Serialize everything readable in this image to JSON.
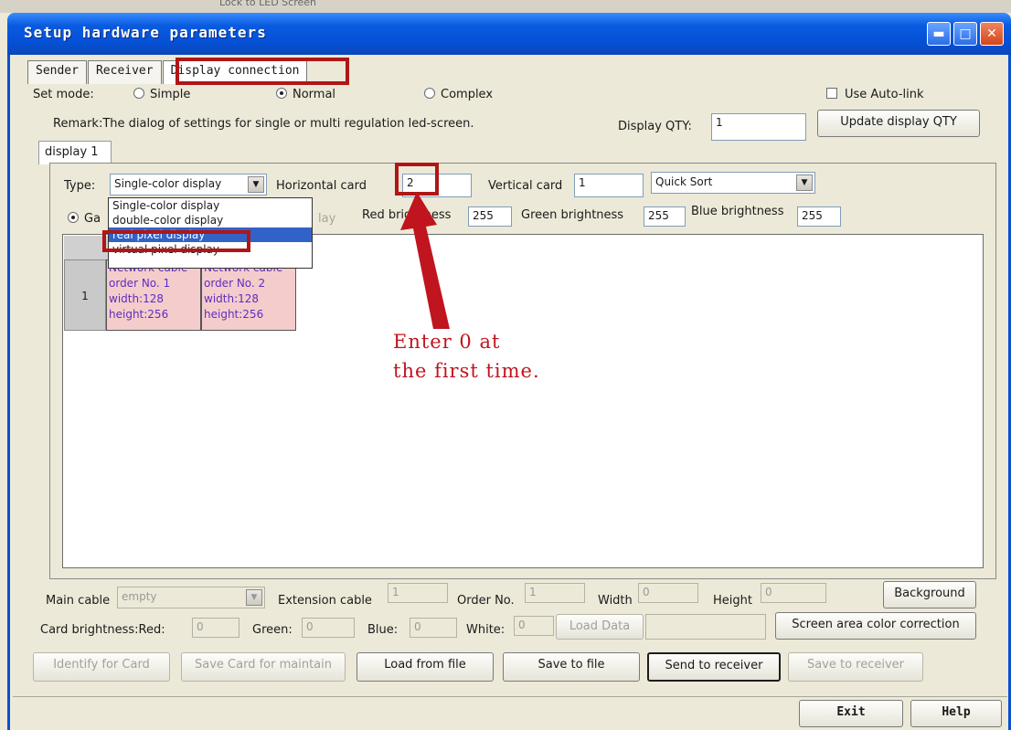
{
  "window": {
    "title": "Setup hardware parameters",
    "background_title_fragment": "Lock to LED Screen"
  },
  "tabs": [
    "Sender",
    "Receiver",
    "Display connection"
  ],
  "set_mode": {
    "label": "Set mode:",
    "options": [
      "Simple",
      "Normal",
      "Complex"
    ],
    "selected": "Normal"
  },
  "auto_link": {
    "label": "Use Auto-link",
    "checked": false
  },
  "remark": "Remark:The dialog of settings for single or multi  regulation led-screen.",
  "display_qty": {
    "label": "Display QTY:",
    "value": "1",
    "update_button": "Update display QTY"
  },
  "display_tab": "display 1",
  "type": {
    "label": "Type:",
    "value": "Single-color display",
    "options": [
      "Single-color display",
      "double-color display",
      "real pixel display",
      "virtual pixel display"
    ],
    "highlighted": "real pixel display"
  },
  "horizontal_card": {
    "label": "Horizontal card",
    "value": "2"
  },
  "vertical_card": {
    "label": "Vertical card",
    "value": "1"
  },
  "sort": {
    "value": "Quick Sort"
  },
  "mode_radio_partial": "Ga",
  "partial_lay": "lay",
  "brightness": {
    "red_label": "Red brightness",
    "red": "255",
    "green_label": "Green brightness",
    "green": "255",
    "blue_label": "Blue brightness",
    "blue": "255"
  },
  "grid": {
    "row_label": "1",
    "cells": [
      {
        "l1": "Network cable",
        "l2": "order No. 1",
        "l3": "width:128",
        "l4": "height:256"
      },
      {
        "l1": "Network cable",
        "l2": "order No. 2",
        "l3": "width:128",
        "l4": "height:256"
      }
    ]
  },
  "annotation": {
    "line1": "Enter 0 at",
    "line2": "the first time."
  },
  "bottom": {
    "main_cable_label": "Main cable",
    "main_cable_value": "empty",
    "extension_cable_label": "Extension cable",
    "extension_cable_value": "1",
    "order_label": "Order No.",
    "order_value": "1",
    "width_label": "Width",
    "width_value": "0",
    "height_label": "Height",
    "height_value": "0",
    "background_button": "Background",
    "card_brightness_label": "Card brightness:Red:",
    "red_value": "0",
    "green_label": "Green:",
    "green_value": "0",
    "blue_label": "Blue:",
    "blue_value": "0",
    "white_label": "White:",
    "white_value": "0",
    "load_data_button": "Load Data",
    "screen_area_button": "Screen area color correction"
  },
  "actions": {
    "identify": "Identify for Card",
    "save_card": "Save Card for maintain",
    "load_file": "Load from file",
    "save_file": "Save to file",
    "send_receiver": "Send to receiver",
    "save_receiver": "Save to receiver"
  },
  "footer": {
    "exit": "Exit",
    "help": "Help"
  },
  "colors": {
    "titlebar": "#0a5be0",
    "highlight": "#b01616",
    "annotation": "#c0141e",
    "cell_bg": "#f5cccc"
  }
}
